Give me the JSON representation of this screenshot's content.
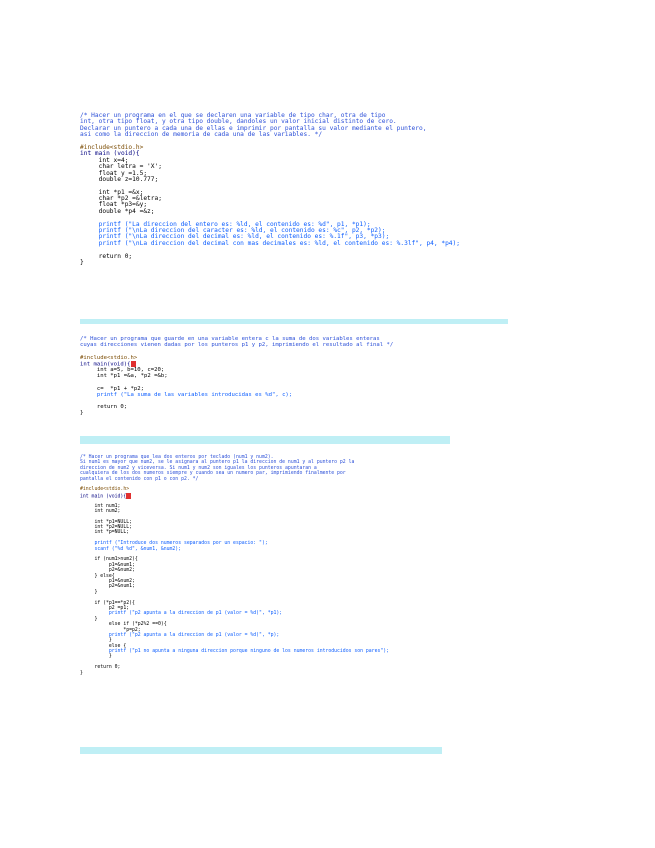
{
  "block1": {
    "lines": [
      {
        "t": "/* Hacer un programa en el que se declaren una variable de tipo char, otra de tipo",
        "c": "comment"
      },
      {
        "t": "int, otra tipo float, y otra tipo double, dandoles un valor inicial distinto de cero.",
        "c": "comment"
      },
      {
        "t": "Declarar un puntero a cada una de ellas e imprimir por pantalla su valor mediante el puntero,",
        "c": "comment"
      },
      {
        "t": "asi como la direccion de memoria de cada una de las variables. */",
        "c": "comment"
      },
      {
        "t": "",
        "c": ""
      },
      {
        "t": "#include<stdio.h>",
        "c": "directive"
      },
      {
        "t": "int main (void){",
        "c": "kw"
      },
      {
        "t": "     int x=4;",
        "c": ""
      },
      {
        "t": "     char letra = 'X';",
        "c": ""
      },
      {
        "t": "     float y =1.5;",
        "c": ""
      },
      {
        "t": "     double z=10.777;",
        "c": ""
      },
      {
        "t": "",
        "c": ""
      },
      {
        "t": "     int *p1 =&x;",
        "c": ""
      },
      {
        "t": "     char *p2 =&letra;",
        "c": ""
      },
      {
        "t": "     float *p3=&y;",
        "c": ""
      },
      {
        "t": "     double *p4 =&z;",
        "c": ""
      },
      {
        "t": "",
        "c": ""
      },
      {
        "t": "     printf (\"La direccion del entero es: %ld, el contenido es: %d\", p1, *p1);",
        "c": "str"
      },
      {
        "t": "     printf (\"\\nLa direccion del caracter es: %ld, el contenido es: %c\", p2, *p2);",
        "c": "str"
      },
      {
        "t": "     printf (\"\\nLa direccion del decimal es: %ld, el contenido es: %.1f\", p3, *p3);",
        "c": "str"
      },
      {
        "t": "     printf (\"\\nLa direccion del decimal con mas decimales es: %ld, el contenido es: %.3lf\", p4, *p4);",
        "c": "str"
      },
      {
        "t": "",
        "c": ""
      },
      {
        "t": "     return 0;",
        "c": ""
      },
      {
        "t": "}",
        "c": ""
      }
    ]
  },
  "block2": {
    "lines": [
      {
        "t": "/* Hacer un programa que guarde en una variable entera c la suma de dos variables enteras",
        "c": "comment"
      },
      {
        "t": "cuyas direcciones vienen dadas por los punteros p1 y p2, imprimiendo el resultado al final */",
        "c": "comment"
      },
      {
        "t": "",
        "c": ""
      },
      {
        "t": "#include<stdio.h>",
        "c": "directive"
      },
      {
        "t": "int main(void){",
        "c": "kw"
      },
      {
        "t": "     int a=5, b=10, c=20;",
        "c": ""
      },
      {
        "t": "     int *p1 =&a, *p2 =&b;",
        "c": ""
      },
      {
        "t": "",
        "c": ""
      },
      {
        "t": "     c=  *p1 + *p2;",
        "c": ""
      },
      {
        "t": "     printf (\"La suma de las variables introducidas es %d\", c);",
        "c": "str"
      },
      {
        "t": "",
        "c": ""
      },
      {
        "t": "     return 0;",
        "c": ""
      },
      {
        "t": "}",
        "c": ""
      }
    ]
  },
  "block3": {
    "lines": [
      {
        "t": "/* Hacer un programa que lea dos enteros por teclado (num1 y num2).",
        "c": "comment"
      },
      {
        "t": "Si num1 es mayor que num2, se le asignara al puntero p1 la direccion de num1 y al puntero p2 la",
        "c": "comment"
      },
      {
        "t": "direccion de num2 y viceversa. Si num1 y num2 son iguales los punteros apuntaran a",
        "c": "comment"
      },
      {
        "t": "cualquiera de los dos numeros siempre y cuando sea un numero par, imprimiendo finalmente por",
        "c": "comment"
      },
      {
        "t": "pantalla el contenido con p1 o con p2. */",
        "c": "comment"
      },
      {
        "t": "",
        "c": ""
      },
      {
        "t": "#include<stdio.h>",
        "c": "directive"
      },
      {
        "t": "int main (void){",
        "c": "kw"
      },
      {
        "t": "",
        "c": ""
      },
      {
        "t": "     int num1;",
        "c": ""
      },
      {
        "t": "     int num2;",
        "c": ""
      },
      {
        "t": "",
        "c": ""
      },
      {
        "t": "     int *p1=NULL;",
        "c": ""
      },
      {
        "t": "     int *p2=NULL;",
        "c": ""
      },
      {
        "t": "     int *p=NULL;",
        "c": ""
      },
      {
        "t": "",
        "c": ""
      },
      {
        "t": "     printf (\"Introduce dos numeros separados por un espacio: \");",
        "c": "str"
      },
      {
        "t": "     scanf (\"%d %d\", &num1, &num2);",
        "c": "str"
      },
      {
        "t": "",
        "c": ""
      },
      {
        "t": "     if (num1>num2){",
        "c": ""
      },
      {
        "t": "          p1=&num1;",
        "c": ""
      },
      {
        "t": "          p2=&num2;",
        "c": ""
      },
      {
        "t": "     } else{",
        "c": ""
      },
      {
        "t": "          p1=&num2;",
        "c": ""
      },
      {
        "t": "          p2=&num1;",
        "c": ""
      },
      {
        "t": "     }",
        "c": ""
      },
      {
        "t": "",
        "c": ""
      },
      {
        "t": "     if (*p1==*p2){",
        "c": ""
      },
      {
        "t": "          p2 =p1;",
        "c": ""
      },
      {
        "t": "          printf (\"p2 apunta a la direccion de p1 (valor = %d)\", *p1);",
        "c": "str"
      },
      {
        "t": "     }",
        "c": ""
      },
      {
        "t": "          else if (*p2%2 ==0){",
        "c": ""
      },
      {
        "t": "               *p=p2;",
        "c": ""
      },
      {
        "t": "          printf (\"p2 apunta a la direccion de p1 (valor = %d)\", *p);",
        "c": "str"
      },
      {
        "t": "          }",
        "c": ""
      },
      {
        "t": "          else {",
        "c": ""
      },
      {
        "t": "          printf (\"p1 no apunta a ninguna direccion porque ninguno de los numeros introducidos son pares\");",
        "c": "str"
      },
      {
        "t": "          }",
        "c": ""
      },
      {
        "t": "",
        "c": ""
      },
      {
        "t": "     return 0;",
        "c": ""
      },
      {
        "t": "}",
        "c": ""
      }
    ]
  }
}
